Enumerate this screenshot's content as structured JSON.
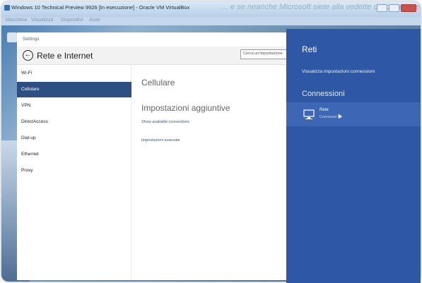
{
  "window": {
    "title": "Windows 10 Technical Preview 9926 [In esecuzione] - Oracle VM VirtualBox",
    "ghost_text": "… e se neanche Microsoft siete alla vedette dal ce ne avete diritto",
    "menu": [
      "Macchina",
      "Visualizza",
      "Dispositivi",
      "Aiuto"
    ]
  },
  "settings": {
    "app_title": "Settings",
    "header": "Rete e Internet",
    "search_placeholder": "Cerca un'impostazione",
    "nav": [
      "Wi-Fi",
      "Cellulare",
      "VPN",
      "DirectAccess",
      "Dial-up",
      "Ethernet",
      "Proxy"
    ],
    "active_nav": "Cellulare",
    "content": {
      "title": "Cellulare",
      "subtitle": "Impostazioni aggiuntive",
      "link1": "Show available connections",
      "link2": "Impostazioni avanzate"
    }
  },
  "flyout": {
    "title": "Reti",
    "link": "Visualizza impostazioni connessioni",
    "section": "Connessioni",
    "network": {
      "name": "Rete",
      "status": "Connesso"
    }
  },
  "colors": {
    "flyout": "#2e57a5",
    "accent": "#2d4f84"
  }
}
